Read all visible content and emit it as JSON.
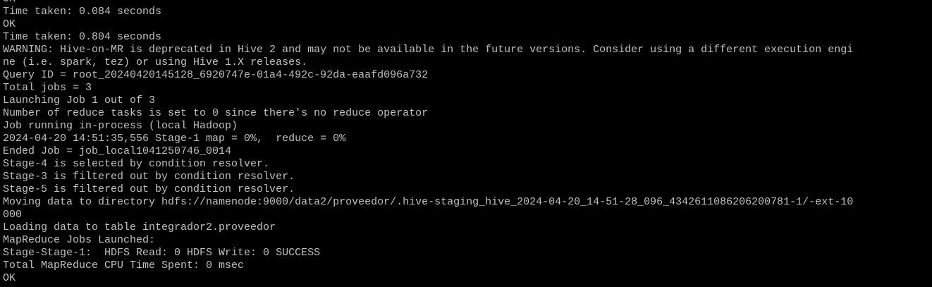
{
  "terminal": {
    "colors": {
      "background": "#000000",
      "foreground": "#c0c0c0"
    },
    "lines": [
      "OK",
      "Time taken: 0.084 seconds",
      "OK",
      "Time taken: 0.804 seconds",
      "WARNING: Hive-on-MR is deprecated in Hive 2 and may not be available in the future versions. Consider using a different execution engi",
      "ne (i.e. spark, tez) or using Hive 1.X releases.",
      "Query ID = root_20240420145128_6920747e-01a4-492c-92da-eaafd096a732",
      "Total jobs = 3",
      "Launching Job 1 out of 3",
      "Number of reduce tasks is set to 0 since there's no reduce operator",
      "Job running in-process (local Hadoop)",
      "2024-04-20 14:51:35,556 Stage-1 map = 0%,  reduce = 0%",
      "Ended Job = job_local1041250746_0014",
      "Stage-4 is selected by condition resolver.",
      "Stage-3 is filtered out by condition resolver.",
      "Stage-5 is filtered out by condition resolver.",
      "Moving data to directory hdfs://namenode:9000/data2/proveedor/.hive-staging_hive_2024-04-20_14-51-28_096_4342611086206200781-1/-ext-10",
      "000",
      "Loading data to table integrador2.proveedor",
      "MapReduce Jobs Launched:",
      "Stage-Stage-1:  HDFS Read: 0 HDFS Write: 0 SUCCESS",
      "Total MapReduce CPU Time Spent: 0 msec",
      "OK"
    ]
  }
}
